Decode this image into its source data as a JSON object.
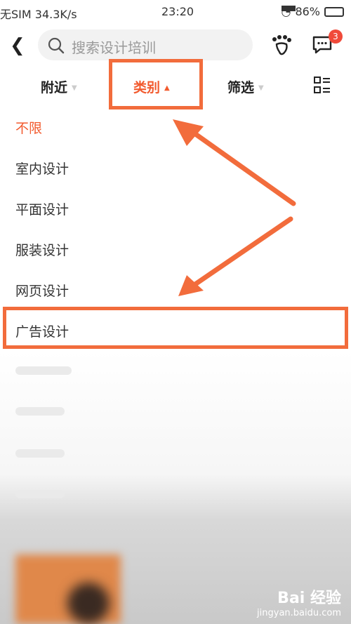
{
  "status": {
    "carrier": "无SIM 34.3K/s",
    "time": "23:20",
    "battery": "86%"
  },
  "search": {
    "placeholder": "搜索设计培训",
    "badge_count": "3"
  },
  "filters": {
    "nearby": "附近",
    "category": "类别",
    "filter": "筛选"
  },
  "categories": [
    "不限",
    "室内设计",
    "平面设计",
    "服装设计",
    "网页设计",
    "广告设计"
  ],
  "selected_category": "不限",
  "watermark": {
    "brand": "Bai 经验",
    "site": "jingyan.baidu.com"
  },
  "colors": {
    "accent": "#f25a2e",
    "annotation": "#f26c3c",
    "badge": "#f04a3a"
  }
}
